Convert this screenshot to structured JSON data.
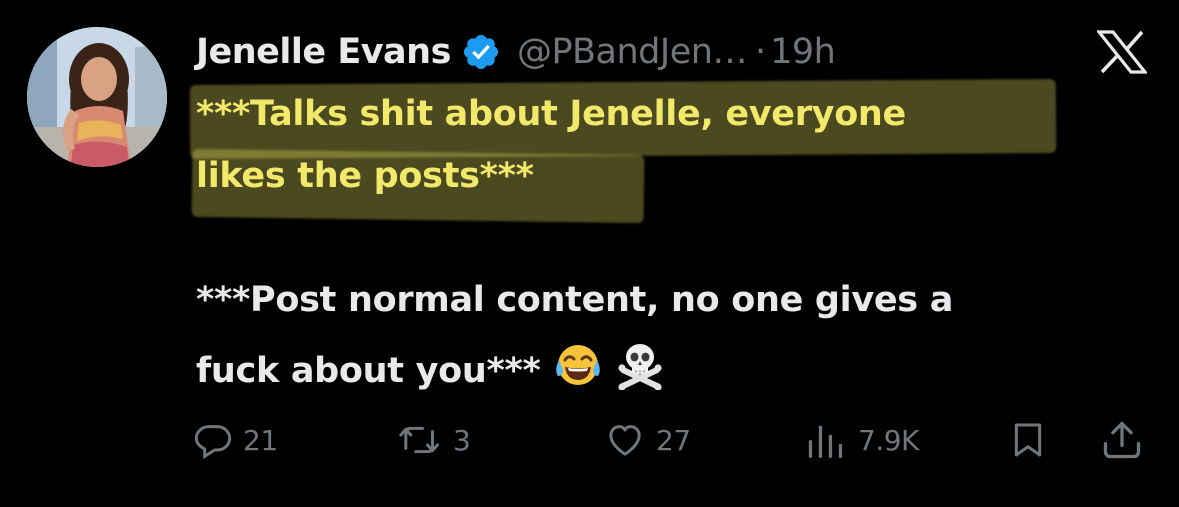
{
  "tweet": {
    "author": {
      "display_name": "Jenelle Evans",
      "handle": "@PBandJen…",
      "verified": true
    },
    "separator": "·",
    "time": "19h",
    "body": {
      "line1": "***Talks shit about Jenelle, everyone",
      "line2": "likes the posts***",
      "line3": "***Post normal content, no one gives a",
      "line4": "fuck about you***"
    },
    "emojis": [
      "face-with-tears-of-joy",
      "skull-and-crossbones"
    ],
    "metrics": {
      "replies": "21",
      "reposts": "3",
      "likes": "27",
      "views": "7.9K"
    }
  },
  "icons": {
    "platform": "x-logo",
    "reply": "speech-bubble-icon",
    "repost": "repost-arrows-icon",
    "like": "heart-icon",
    "views": "bar-chart-icon",
    "bookmark": "bookmark-icon",
    "share": "share-upload-icon"
  },
  "colors": {
    "background": "#000000",
    "text": "#e7e9ea",
    "secondary_text": "#71767b",
    "verified_badge": "#1d9bf0",
    "highlight": "#e9e260",
    "highlighted_text": "#f2e86a"
  }
}
